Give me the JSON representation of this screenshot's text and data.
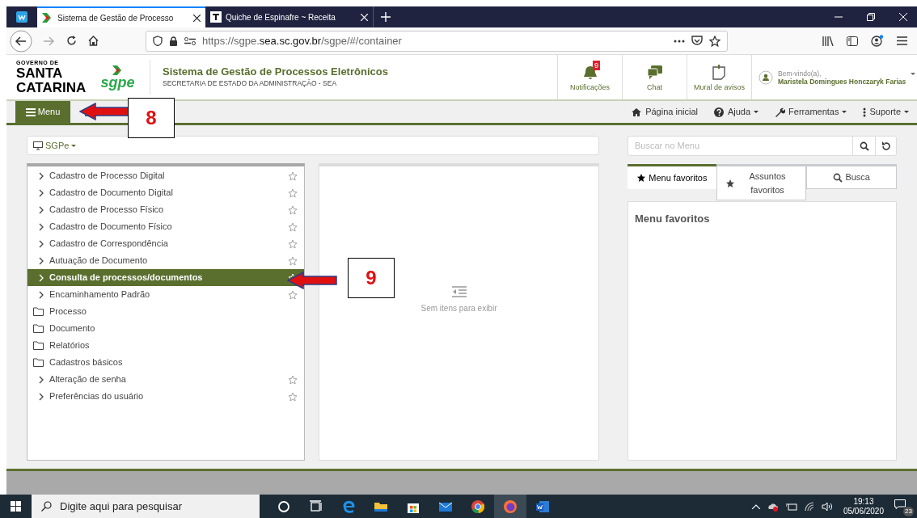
{
  "browser": {
    "tabs": [
      {
        "title": "Sistema de Gestão de Processo",
        "selected": true
      },
      {
        "title": "Quiche de Espinafre ~ Receita",
        "selected": false
      }
    ],
    "url": {
      "prefix": "https://sgpe.",
      "domain": "sea.sc.gov.br",
      "path": "/sgpe/#/container"
    }
  },
  "header": {
    "logo_top": "GOVERNO DE",
    "logo_line1": "SANTA",
    "logo_line2": "CATARINA",
    "app_logo": "sgpe",
    "title": "Sistema de Gestão de Processos Eletrônicos",
    "subtitle": "SECRETARIA DE ESTADO DA ADMINISTRAÇÃO - SEA",
    "actions": [
      {
        "kind": "bell",
        "label": "Notificações",
        "badge": "9"
      },
      {
        "kind": "chat",
        "label": "Chat"
      },
      {
        "kind": "board",
        "label": "Mural de avisos"
      }
    ],
    "user": {
      "greeting": "Bem-vindo(a),",
      "name": "Maristela Domingues Honczaryk Farias"
    }
  },
  "navbar": {
    "menu_button": "Menu",
    "links": [
      {
        "kind": "home",
        "label": "Página inicial",
        "dropdown": false
      },
      {
        "kind": "help",
        "label": "Ajuda",
        "dropdown": true
      },
      {
        "kind": "tools",
        "label": "Ferramentas",
        "dropdown": true
      },
      {
        "kind": "more",
        "label": "Suporte",
        "dropdown": true
      }
    ]
  },
  "system_selector": "SGPe",
  "menu_items": [
    {
      "kind": "item",
      "label": "Cadastro de Processo Digital",
      "selected": false
    },
    {
      "kind": "item",
      "label": "Cadastro de Documento Digital",
      "selected": false
    },
    {
      "kind": "item",
      "label": "Cadastro de Processo Físico",
      "selected": false
    },
    {
      "kind": "item",
      "label": "Cadastro de Documento Físico",
      "selected": false
    },
    {
      "kind": "item",
      "label": "Cadastro de Correspondência",
      "selected": false
    },
    {
      "kind": "item",
      "label": "Autuação de Documento",
      "selected": false
    },
    {
      "kind": "item",
      "label": "Consulta de processos/documentos",
      "selected": true
    },
    {
      "kind": "item",
      "label": "Encaminhamento Padrão",
      "selected": false
    },
    {
      "kind": "folder",
      "label": "Processo",
      "selected": false
    },
    {
      "kind": "folder",
      "label": "Documento",
      "selected": false
    },
    {
      "kind": "folder",
      "label": "Relatórios",
      "selected": false
    },
    {
      "kind": "folder",
      "label": "Cadastros básicos",
      "selected": false
    },
    {
      "kind": "item",
      "label": "Alteração de senha",
      "selected": false
    },
    {
      "kind": "item",
      "label": "Preferências do usuário",
      "selected": false
    }
  ],
  "empty_panel": {
    "message": "Sem itens para exibir"
  },
  "search": {
    "placeholder": "Buscar no Menu"
  },
  "right_tabs": [
    {
      "kind": "star",
      "label": "Menu favoritos",
      "selected": true
    },
    {
      "kind": "star",
      "label": "Assuntos favoritos",
      "selected": false
    },
    {
      "kind": "search",
      "label": "Busca",
      "selected": false
    }
  ],
  "right_panel": {
    "heading": "Menu favoritos"
  },
  "annotations": [
    {
      "label": "8"
    },
    {
      "label": "9"
    }
  ],
  "taskbar": {
    "search_placeholder": "Digite aqui para pesquisar",
    "time": "19:13",
    "date": "05/06/2020",
    "notifications": "23"
  }
}
